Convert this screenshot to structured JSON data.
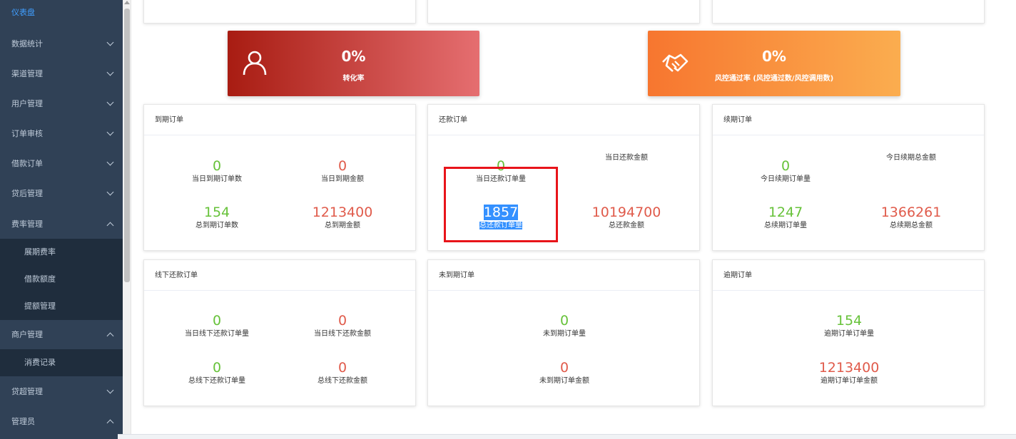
{
  "sidebar": {
    "items": [
      {
        "label": "仪表盘",
        "active": true
      },
      {
        "label": "数据统计"
      },
      {
        "label": "渠道管理"
      },
      {
        "label": "用户管理"
      },
      {
        "label": "订单审核"
      },
      {
        "label": "借款订单"
      },
      {
        "label": "贷后管理"
      },
      {
        "label": "费率管理"
      },
      {
        "label": "商户管理"
      },
      {
        "label": "贷超管理"
      },
      {
        "label": "管理员"
      }
    ],
    "sub_rate": [
      "展期费率",
      "借款额度",
      "提额管理"
    ],
    "sub_merchant": [
      "消费记录"
    ]
  },
  "banners": [
    {
      "pct": "0%",
      "caption": "转化率",
      "icon": "user-icon",
      "color_from": "#a81c12",
      "color_to": "#e56e70"
    },
    {
      "pct": "0%",
      "caption": "风控通过率 (风控通过数/风控调用数)",
      "icon": "handshake-icon",
      "color_from": "#f7762f",
      "color_to": "#fbad4f"
    }
  ],
  "cards": {
    "expire": {
      "title": "到期订单",
      "stats": [
        {
          "value": "0",
          "label": "当日到期订单数"
        },
        {
          "value": "0",
          "label": "当日到期金额"
        },
        {
          "value": "154",
          "label": "总到期订单数"
        },
        {
          "value": "1213400",
          "label": "总到期金额"
        }
      ]
    },
    "repay": {
      "title": "还款订单",
      "stats": [
        {
          "value": "0",
          "label": "当日还款订单量"
        },
        {
          "value": "",
          "label": "当日还款金额"
        },
        {
          "value": "1857",
          "label": "总还款订单量"
        },
        {
          "value": "10194700",
          "label": "总还款金额"
        }
      ]
    },
    "renew": {
      "title": "续期订单",
      "stats": [
        {
          "value": "0",
          "label": "今日续期订单量"
        },
        {
          "value": "",
          "label": "今日续期总金额"
        },
        {
          "value": "1247",
          "label": "总续期订单量"
        },
        {
          "value": "1366261",
          "label": "总续期总金额"
        }
      ]
    },
    "offline": {
      "title": "线下还款订单",
      "stats": [
        {
          "value": "0",
          "label": "当日线下还款订单量"
        },
        {
          "value": "0",
          "label": "当日线下还款金额"
        },
        {
          "value": "0",
          "label": "总线下还款订单量"
        },
        {
          "value": "0",
          "label": "总线下还款金额"
        }
      ]
    },
    "notdue": {
      "title": "未到期订单",
      "stats": [
        {
          "value": "0",
          "label": "未到期订单量"
        },
        {
          "value": "0",
          "label": "未到期订单金额"
        }
      ]
    },
    "overdue": {
      "title": "逾期订单",
      "stats": [
        {
          "value": "154",
          "label": "逾期订单订单量"
        },
        {
          "value": "1213400",
          "label": "逾期订单订单金额"
        }
      ]
    }
  }
}
